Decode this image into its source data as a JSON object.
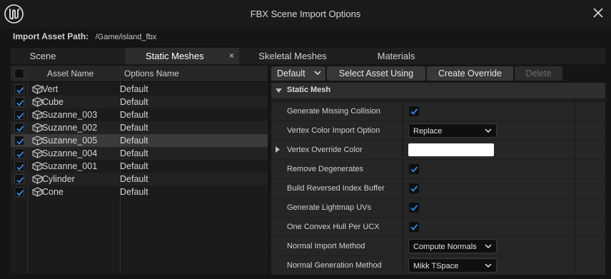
{
  "window": {
    "title": "FBX Scene Import Options"
  },
  "import_path": {
    "label": "Import Asset Path:",
    "value": "/Game/island_fbx"
  },
  "tabs": [
    {
      "label": "Scene",
      "active": false
    },
    {
      "label": "Static Meshes",
      "active": true,
      "close": "×"
    },
    {
      "label": "Skeletal Meshes",
      "active": false
    },
    {
      "label": "Materials",
      "active": false
    }
  ],
  "asset_list": {
    "columns": {
      "asset_name": "Asset Name",
      "options_name": "Options Name"
    },
    "rows": [
      {
        "name": "Vert",
        "option": "Default",
        "checked": true,
        "selected": false
      },
      {
        "name": "Cube",
        "option": "Default",
        "checked": true,
        "selected": false
      },
      {
        "name": "Suzanne_003",
        "option": "Default",
        "checked": true,
        "selected": false
      },
      {
        "name": "Suzanne_002",
        "option": "Default",
        "checked": true,
        "selected": false
      },
      {
        "name": "Suzanne_005",
        "option": "Default",
        "checked": true,
        "selected": true
      },
      {
        "name": "Suzanne_004",
        "option": "Default",
        "checked": true,
        "selected": false
      },
      {
        "name": "Suzanne_001",
        "option": "Default",
        "checked": true,
        "selected": false
      },
      {
        "name": "Cylinder",
        "option": "Default",
        "checked": true,
        "selected": false
      },
      {
        "name": "Cone",
        "option": "Default",
        "checked": true,
        "selected": false
      }
    ]
  },
  "toolbar": {
    "options_dropdown": "Default",
    "select_asset_using": "Select Asset Using",
    "create_override": "Create Override",
    "delete": "Delete"
  },
  "details": {
    "section": "Static Mesh",
    "properties": [
      {
        "label": "Generate Missing Collision",
        "type": "checkbox",
        "checked": true
      },
      {
        "label": "Vertex Color Import Option",
        "type": "dropdown",
        "value": "Replace"
      },
      {
        "label": "Vertex Override Color",
        "type": "color",
        "value": "#ffffff"
      },
      {
        "label": "Remove Degenerates",
        "type": "checkbox",
        "checked": true
      },
      {
        "label": "Build Reversed Index Buffer",
        "type": "checkbox",
        "checked": true
      },
      {
        "label": "Generate Lightmap UVs",
        "type": "checkbox",
        "checked": true
      },
      {
        "label": "One Convex Hull Per UCX",
        "type": "checkbox",
        "checked": true
      },
      {
        "label": "Normal Import Method",
        "type": "dropdown",
        "value": "Compute Normals"
      },
      {
        "label": "Normal Generation Method",
        "type": "dropdown",
        "value": "Mikk TSpace"
      }
    ]
  },
  "colors": {
    "accent_check": "#2f8ce6",
    "background": "#151515",
    "panel": "#1d1d1d"
  }
}
